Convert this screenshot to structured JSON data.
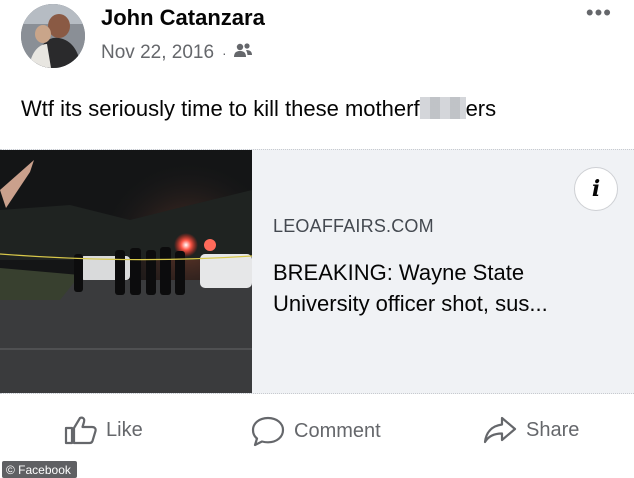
{
  "post": {
    "author": "John Catanzara",
    "date": "Nov 22, 2016",
    "separator": "·",
    "audience_icon": "friends-icon",
    "menu_icon": "more-icon",
    "text_before": "Wtf its seriously time to kill these motherf",
    "text_after": "ers"
  },
  "link_card": {
    "domain": "LEOAFFAIRS.COM",
    "headline": "BREAKING: Wayne State University officer shot, sus...",
    "info_label": "i"
  },
  "actions": {
    "like": "Like",
    "comment": "Comment",
    "share": "Share"
  },
  "watermark": "© Facebook",
  "colors": {
    "text_primary": "#050505",
    "text_secondary": "#65676b",
    "card_background": "#f0f2f5"
  }
}
